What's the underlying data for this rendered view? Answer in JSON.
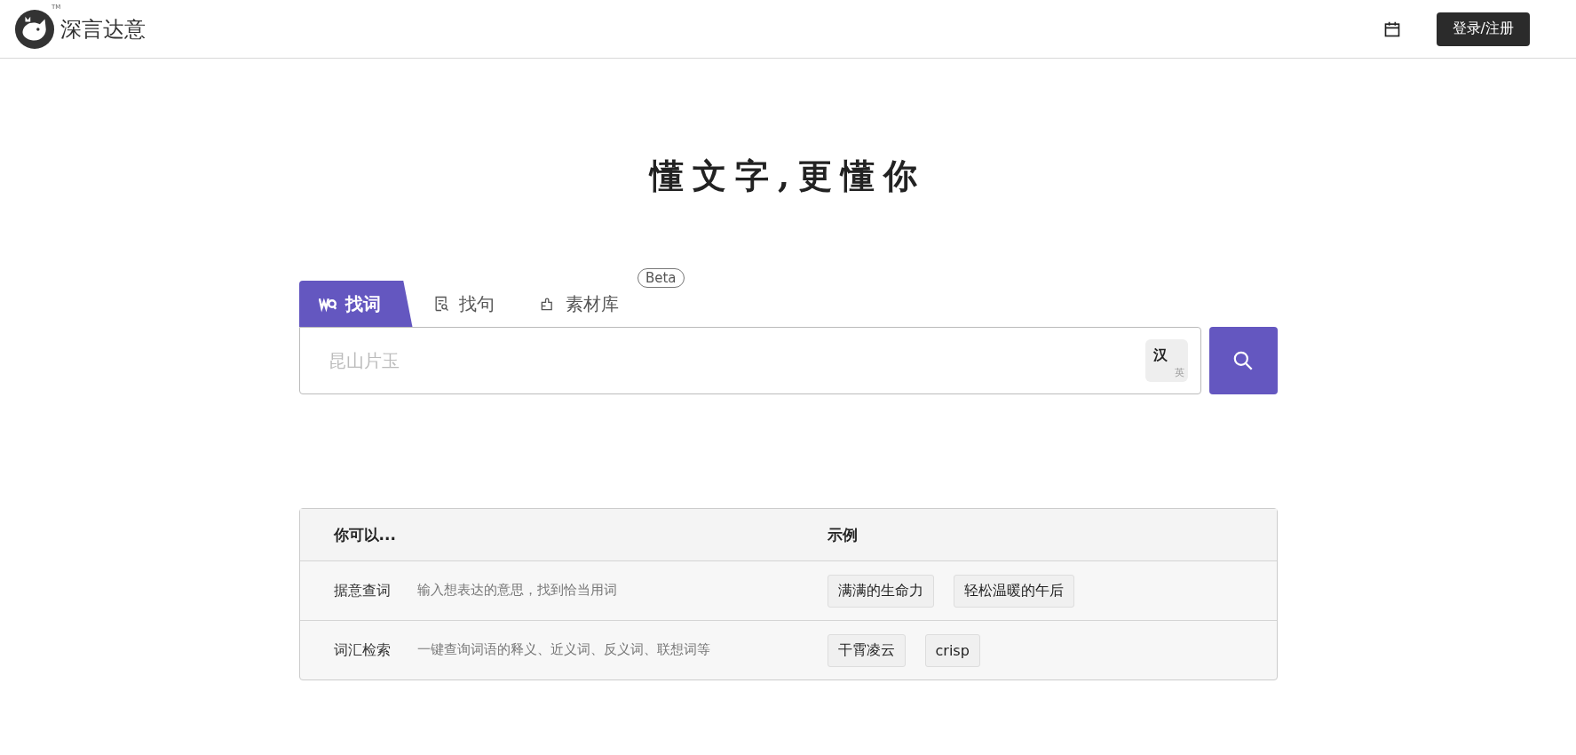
{
  "header": {
    "brand": "深言达意",
    "trademark": "TM",
    "login_button": "登录/注册"
  },
  "slogan": "懂文字,更懂你",
  "tabs": [
    {
      "label": "找词",
      "selected": true
    },
    {
      "label": "找句",
      "selected": false
    },
    {
      "label": "素材库",
      "selected": false,
      "badge": "Beta"
    }
  ],
  "search": {
    "placeholder": "昆山片玉",
    "lang_toggle": {
      "primary": "汉",
      "secondary": "英"
    }
  },
  "table": {
    "columns": [
      "你可以...",
      "示例"
    ],
    "rows": [
      {
        "feature": "据意查词",
        "description": "输入想表达的意思，找到恰当用词",
        "examples": [
          "满满的生命力",
          "轻松温暖的午后"
        ]
      },
      {
        "feature": "词汇检索",
        "description": "一键查询词语的释义、近义词、反义词、联想词等",
        "examples": [
          "干霄凌云",
          "crisp"
        ]
      }
    ]
  }
}
